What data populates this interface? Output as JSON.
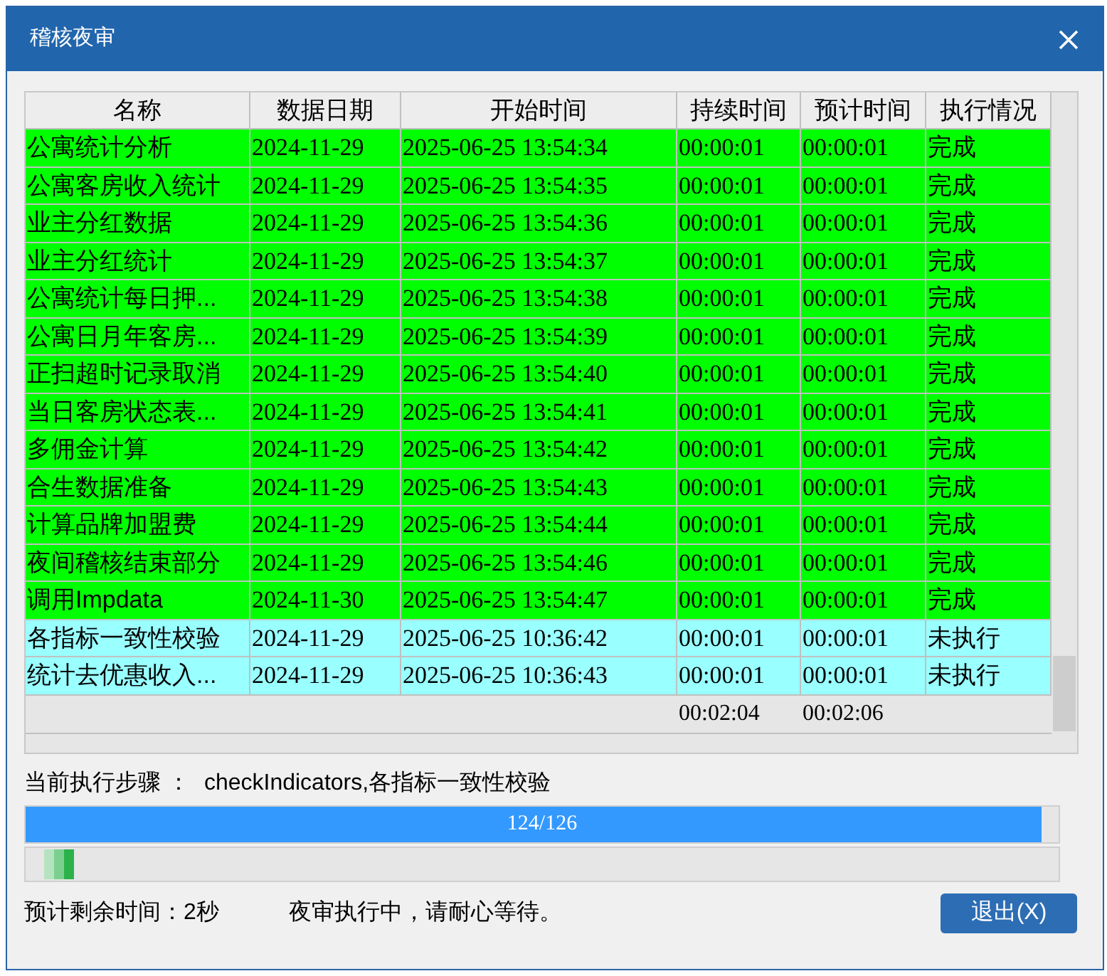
{
  "window": {
    "title": "稽核夜审"
  },
  "table": {
    "columns": [
      "名称",
      "数据日期",
      "开始时间",
      "持续时间",
      "预计时间",
      "执行情况"
    ],
    "rows": [
      {
        "cells": [
          "公寓统计分析",
          "2024-11-29",
          "2025-06-25 13:54:34",
          "00:00:01",
          "00:00:01",
          "完成"
        ],
        "color": "#00ff00"
      },
      {
        "cells": [
          "公寓客房收入统计",
          "2024-11-29",
          "2025-06-25 13:54:35",
          "00:00:01",
          "00:00:01",
          "完成"
        ],
        "color": "#00ff00"
      },
      {
        "cells": [
          "业主分红数据",
          "2024-11-29",
          "2025-06-25 13:54:36",
          "00:00:01",
          "00:00:01",
          "完成"
        ],
        "color": "#00ff00"
      },
      {
        "cells": [
          "业主分红统计",
          "2024-11-29",
          "2025-06-25 13:54:37",
          "00:00:01",
          "00:00:01",
          "完成"
        ],
        "color": "#00ff00"
      },
      {
        "cells": [
          "公寓统计每日押...",
          "2024-11-29",
          "2025-06-25 13:54:38",
          "00:00:01",
          "00:00:01",
          "完成"
        ],
        "color": "#00ff00"
      },
      {
        "cells": [
          "公寓日月年客房...",
          "2024-11-29",
          "2025-06-25 13:54:39",
          "00:00:01",
          "00:00:01",
          "完成"
        ],
        "color": "#00ff00"
      },
      {
        "cells": [
          "正扫超时记录取消",
          "2024-11-29",
          "2025-06-25 13:54:40",
          "00:00:01",
          "00:00:01",
          "完成"
        ],
        "color": "#00ff00"
      },
      {
        "cells": [
          "当日客房状态表...",
          "2024-11-29",
          "2025-06-25 13:54:41",
          "00:00:01",
          "00:00:01",
          "完成"
        ],
        "color": "#00ff00"
      },
      {
        "cells": [
          "多佣金计算",
          "2024-11-29",
          "2025-06-25 13:54:42",
          "00:00:01",
          "00:00:01",
          "完成"
        ],
        "color": "#00ff00"
      },
      {
        "cells": [
          "合生数据准备",
          "2024-11-29",
          "2025-06-25 13:54:43",
          "00:00:01",
          "00:00:01",
          "完成"
        ],
        "color": "#00ff00"
      },
      {
        "cells": [
          "计算品牌加盟费",
          "2024-11-29",
          "2025-06-25 13:54:44",
          "00:00:01",
          "00:00:01",
          "完成"
        ],
        "color": "#00ff00"
      },
      {
        "cells": [
          "夜间稽核结束部分",
          "2024-11-29",
          "2025-06-25 13:54:46",
          "00:00:01",
          "00:00:01",
          "完成"
        ],
        "color": "#00ff00"
      },
      {
        "cells": [
          "调用Impdata",
          "2024-11-30",
          "2025-06-25 13:54:47",
          "00:00:01",
          "00:00:01",
          "完成"
        ],
        "color": "#00ff00"
      },
      {
        "cells": [
          "各指标一致性校验",
          "2024-11-29",
          "2025-06-25 10:36:42",
          "00:00:01",
          "00:00:01",
          "未执行"
        ],
        "color": "#99ffff"
      },
      {
        "cells": [
          "统计去优惠收入...",
          "2024-11-29",
          "2025-06-25 10:36:43",
          "00:00:01",
          "00:00:01",
          "未执行"
        ],
        "color": "#99ffff"
      }
    ],
    "totals": {
      "duration": "00:02:04",
      "estimate": "00:02:06"
    }
  },
  "current_step": {
    "label": "当前执行步骤 ：",
    "value": "checkIndicators,各指标一致性校验"
  },
  "progress": {
    "level": 0.984,
    "text": "124/126"
  },
  "remaining": "预计剩余时间：2秒",
  "message": "夜审执行中，请耐心等待。",
  "exit_button": "退出(X)"
}
